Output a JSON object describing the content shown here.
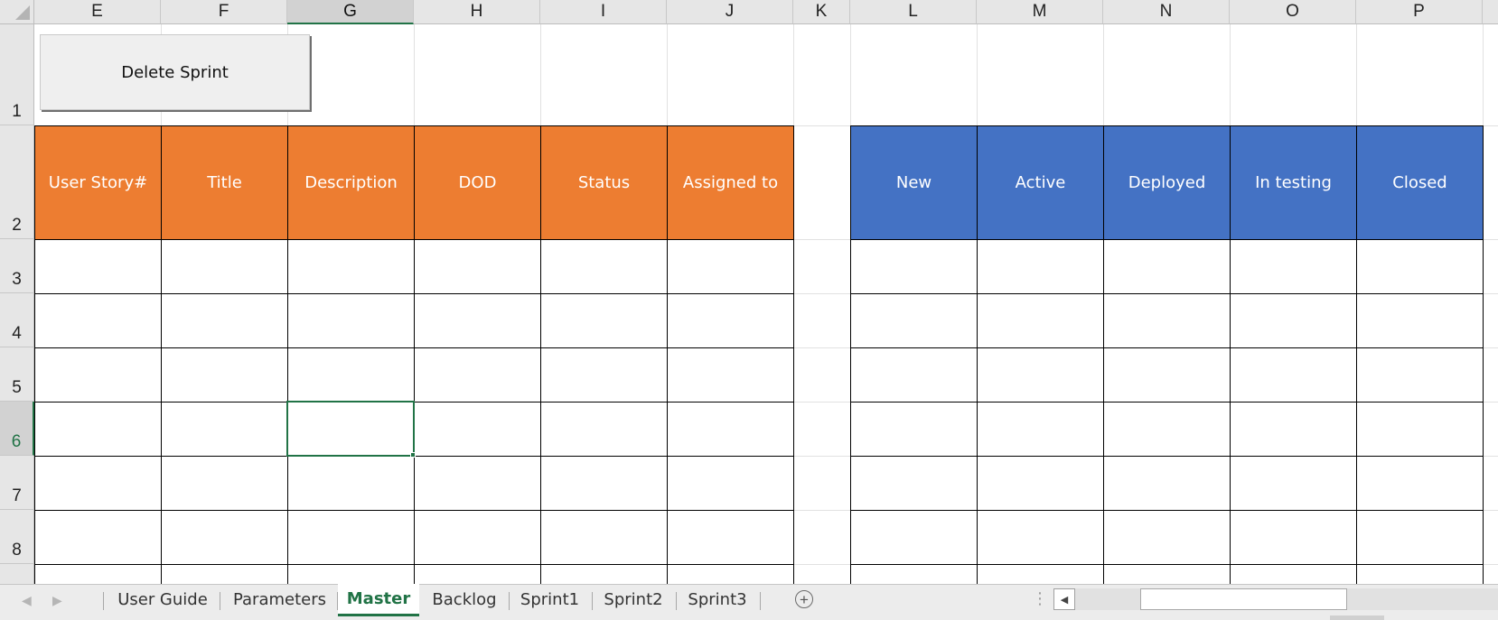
{
  "columns": [
    "E",
    "F",
    "G",
    "H",
    "I",
    "J",
    "K",
    "L",
    "M",
    "N",
    "O",
    "P"
  ],
  "rows": [
    "1",
    "2",
    "3",
    "4",
    "5",
    "6",
    "7",
    "8"
  ],
  "selected_column": "G",
  "selected_row": "6",
  "button": {
    "label": "Delete Sprint"
  },
  "story_headers": [
    "User Story#",
    "Title",
    "Description",
    "DOD",
    "Status",
    "Assigned to"
  ],
  "status_headers": [
    "New",
    "Active",
    "Deployed",
    "In testing",
    "Closed"
  ],
  "colors": {
    "story_header_bg": "#ed7d31",
    "status_header_bg": "#4472c4",
    "selection": "#217346"
  },
  "sheet_tabs": [
    {
      "label": "User Guide",
      "active": false
    },
    {
      "label": "Parameters",
      "active": false
    },
    {
      "label": "Master",
      "active": true
    },
    {
      "label": "Backlog",
      "active": false
    },
    {
      "label": "Sprint1",
      "active": false
    },
    {
      "label": "Sprint2",
      "active": false
    },
    {
      "label": "Sprint3",
      "active": false
    }
  ],
  "tabbar": {
    "add_icon": "plus-circle-icon",
    "options_icon": "vertical-dots-icon"
  }
}
